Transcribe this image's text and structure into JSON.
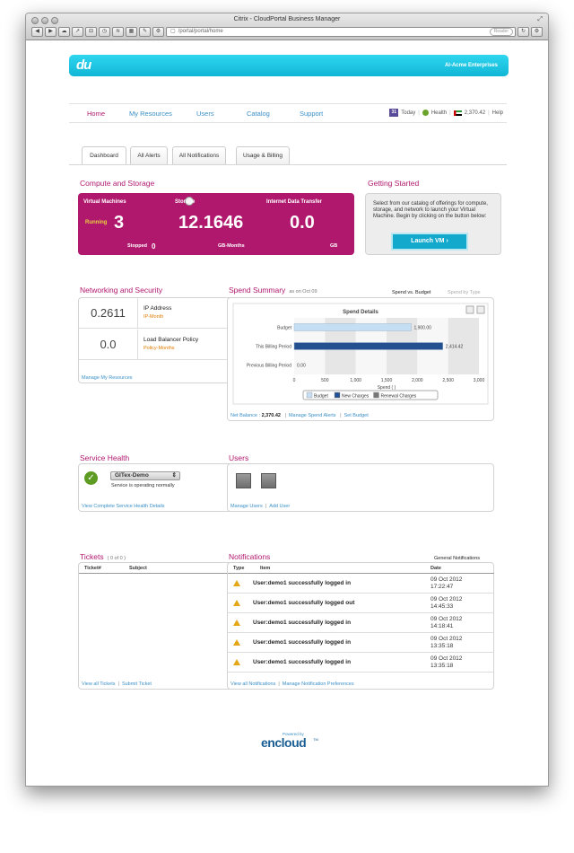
{
  "browser": {
    "window_title": "Citrix - CloudPortal Business Manager",
    "url": "/portal/portal/home",
    "reader_label": "Reader"
  },
  "header": {
    "logo": "du",
    "org_name": "Al-Acme Enterprises"
  },
  "nav": {
    "items": [
      {
        "label": "Home",
        "active": true
      },
      {
        "label": "My Resources"
      },
      {
        "label": "Users"
      },
      {
        "label": "Catalog"
      },
      {
        "label": "Support"
      }
    ],
    "calendar_day": "31",
    "today_label": "Today",
    "health_label": "Health",
    "balance": "2,370.42",
    "help_label": "Help"
  },
  "tabs": [
    "Dashboard",
    "All Alerts",
    "All Notifications",
    "Usage & Billing"
  ],
  "compute": {
    "title": "Compute and Storage",
    "vm_label": "Virtual Machines",
    "running_label": "Running",
    "running_value": "3",
    "stopped_label": "Stopped",
    "stopped_value": "0",
    "storage_label": "Storage",
    "storage_value": "12.1646",
    "storage_unit": "GB-Months",
    "transfer_label": "Internet Data Transfer",
    "transfer_value": "0.0",
    "transfer_unit": "GB"
  },
  "getting_started": {
    "title": "Getting Started",
    "text": "Select from our catalog of offerings for compute, storage, and network to launch your Virtual Machine. Begin by clicking on the button below:",
    "button": "Launch VM"
  },
  "networking": {
    "title": "Networking and Security",
    "rows": [
      {
        "value": "0.2611",
        "name": "IP Address",
        "unit": "IP-Month"
      },
      {
        "value": "0.0",
        "name": "Load Balancer Policy",
        "unit": "Policy-Months"
      }
    ],
    "link": "Manage My Resources"
  },
  "spend": {
    "title": "Spend Summary",
    "as_on": "as on Oct 09",
    "toggle_active": "Spend vs. Budget",
    "toggle_inactive": "Spend by Type",
    "net_balance_label": "Net Balance",
    "net_balance_value": "2,370.42",
    "link_alerts": "Manage Spend Alerts",
    "link_budget": "Set Budget"
  },
  "chart_data": {
    "type": "bar",
    "orientation": "horizontal",
    "title": "Spend Details",
    "xlabel": "Spend ( )",
    "categories": [
      "Budget",
      "This Billing Period",
      "Previous Billing Period"
    ],
    "series": [
      {
        "name": "Budget",
        "color": "#c6def3",
        "values": [
          1900,
          0,
          0
        ]
      },
      {
        "name": "New Charges",
        "color": "#24508f",
        "values": [
          0,
          2414.42,
          0
        ]
      },
      {
        "name": "Renewal Charges",
        "color": "#777777",
        "values": [
          0,
          0,
          0
        ]
      }
    ],
    "data_labels": [
      "1,900.00",
      "2,414.42",
      "0.00"
    ],
    "xlim": [
      0,
      3000
    ],
    "xticks": [
      "0",
      "500",
      "1,000",
      "1,500",
      "2,000",
      "2,500",
      "3,000"
    ],
    "xtick_values": [
      0,
      500,
      1000,
      1500,
      2000,
      2500,
      3000
    ],
    "legend_position": "bottom"
  },
  "service_health": {
    "title": "Service Health",
    "service": "GITex-Demo",
    "status": "Service is operating normally",
    "link": "View Complete Service Health Details"
  },
  "users": {
    "title": "Users",
    "link_manage": "Manage Users",
    "link_add": "Add User"
  },
  "tickets": {
    "title": "Tickets",
    "count": "( 0 of 0 )",
    "col_ticket": "Ticket#",
    "col_subject": "Subject",
    "link_view": "View all Tickets",
    "link_submit": "Submit Ticket"
  },
  "notifications": {
    "title": "Notifications",
    "filter": "General Notifications",
    "col_type": "Type",
    "col_item": "Item",
    "col_date": "Date",
    "rows": [
      {
        "item": "User:demo1 successfully logged in",
        "date": "09 Oct 2012",
        "time": "17:22:47"
      },
      {
        "item": "User:demo1 successfully logged out",
        "date": "09 Oct 2012",
        "time": "14:45:33"
      },
      {
        "item": "User:demo1 successfully logged in",
        "date": "09 Oct 2012",
        "time": "14:18:41"
      },
      {
        "item": "User:demo1 successfully logged in",
        "date": "09 Oct 2012",
        "time": "13:35:18"
      },
      {
        "item": "User:demo1 successfully logged in",
        "date": "09 Oct 2012",
        "time": "13:35:18"
      }
    ],
    "link_view": "View all Notifications",
    "link_manage": "Manage Notification Preferences"
  },
  "footer": {
    "powered_by": "Powered by",
    "brand": "encloud",
    "trademark": "TM"
  }
}
